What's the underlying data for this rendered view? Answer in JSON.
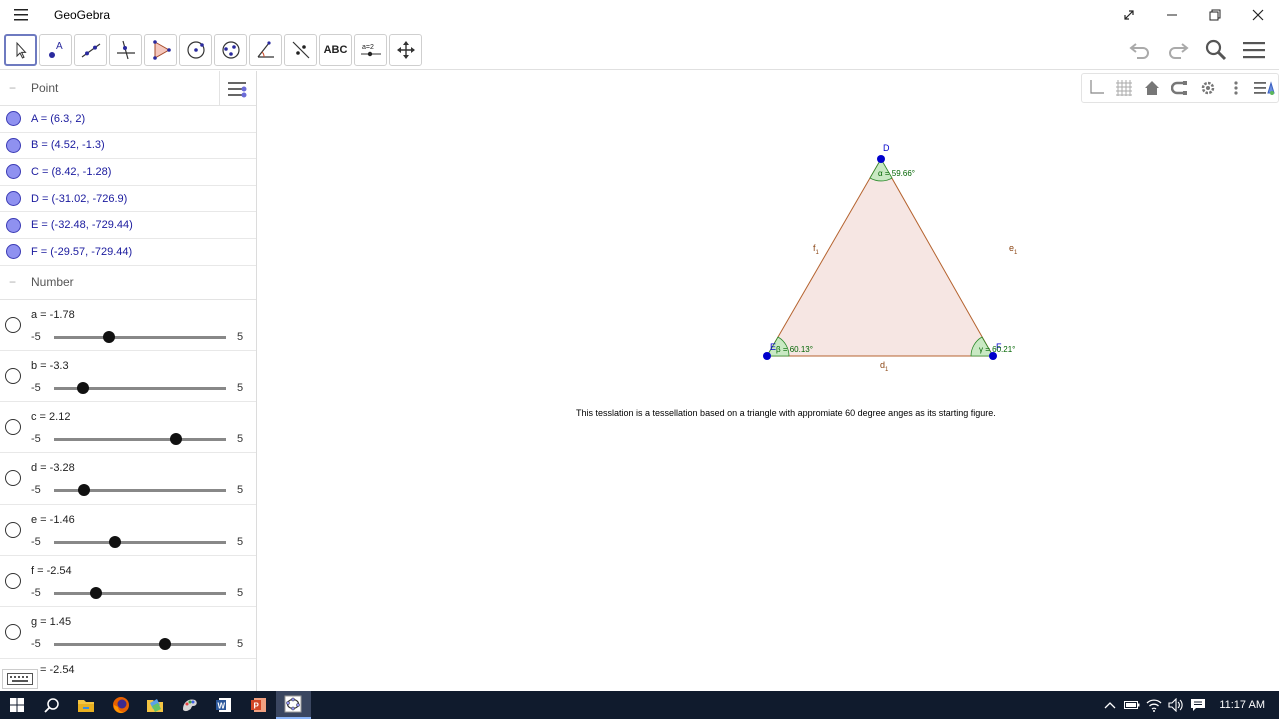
{
  "window": {
    "title": "GeoGebra"
  },
  "toolbar": {
    "text_tool_label": "ABC",
    "slider_tool_label": "a=2"
  },
  "algebra": {
    "point_group_label": "Point",
    "number_group_label": "Number",
    "points": [
      "A = (6.3, 2)",
      "B = (4.52, -1.3)",
      "C = (8.42, -1.28)",
      "D = (-31.02, -726.9)",
      "E = (-32.48, -729.44)",
      "F = (-29.57, -729.44)"
    ],
    "sliders": [
      {
        "label": "a = -1.78",
        "value": -1.78,
        "min": "-5",
        "max": "5"
      },
      {
        "label": "b = -3.3",
        "value": -3.3,
        "min": "-5",
        "max": "5"
      },
      {
        "label": "c = 2.12",
        "value": 2.12,
        "min": "-5",
        "max": "5"
      },
      {
        "label": "d = -3.28",
        "value": -3.28,
        "min": "-5",
        "max": "5"
      },
      {
        "label": "e = -1.46",
        "value": -1.46,
        "min": "-5",
        "max": "5"
      },
      {
        "label": "f = -2.54",
        "value": -2.54,
        "min": "-5",
        "max": "5"
      },
      {
        "label": "g = 1.45",
        "value": 1.45,
        "min": "-5",
        "max": "5"
      }
    ],
    "partial_row_label": "= -2.54"
  },
  "graphics": {
    "vertex_labels": {
      "top": "D",
      "left": "E",
      "right": "F"
    },
    "segment_labels": {
      "left": "f",
      "right": "e",
      "bottom": "d",
      "subscript": "1"
    },
    "angle_labels": {
      "alpha": "α = 59.66°",
      "beta": "β = 60.13°",
      "gamma": "γ = 60.21°"
    },
    "caption": "This tesslation is a tessellation based on a triangle with appromiate 60 degree anges as its starting figure."
  },
  "taskbar": {
    "clock": "11:17 AM"
  },
  "colors": {
    "point_fill": "#8f91f0",
    "point_text": "#1a1a9e",
    "triangle_fill": "#f6e6e3",
    "triangle_edge": "#b5632f",
    "angle_fill": "#c9e9c3",
    "angle_text": "#006400",
    "vertex": "#0000cc",
    "taskbar_bg": "#101b2d"
  }
}
